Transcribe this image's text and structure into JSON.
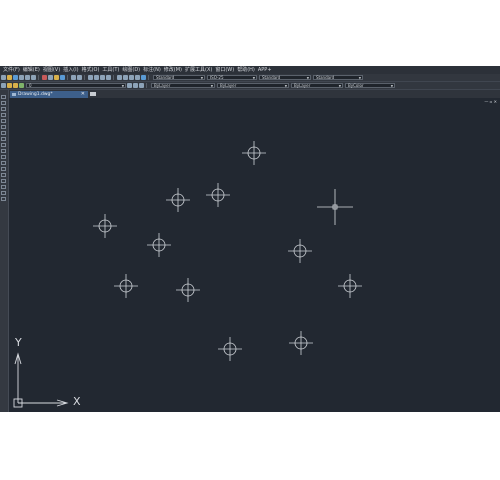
{
  "menu": {
    "items": [
      "文件(F)",
      "编辑(E)",
      "视图(V)",
      "插入(I)",
      "格式(O)",
      "工具(T)",
      "绘图(D)",
      "标注(N)",
      "修改(M)",
      "扩展工具(X)",
      "窗口(W)",
      "帮助(H)",
      "APP+"
    ]
  },
  "styles": {
    "text_style": "Standard",
    "dim_style": "ISO-25",
    "table_style": "Standard",
    "multileader_style": "Standard"
  },
  "properties": {
    "layer": "0",
    "color": "ByLayer",
    "linetype": "ByLayer",
    "lineweight": "ByLayer",
    "plotstyle": "ByColor"
  },
  "tabs": [
    {
      "label": "Drawing1.dwg*"
    }
  ],
  "ucs": {
    "x_label": "X",
    "y_label": "Y"
  },
  "colors": {
    "canvas_bg": "#222831",
    "chrome_bg": "#2b3038",
    "tab_active": "#3d5f8a",
    "crosshair": "#d8dbe0"
  }
}
